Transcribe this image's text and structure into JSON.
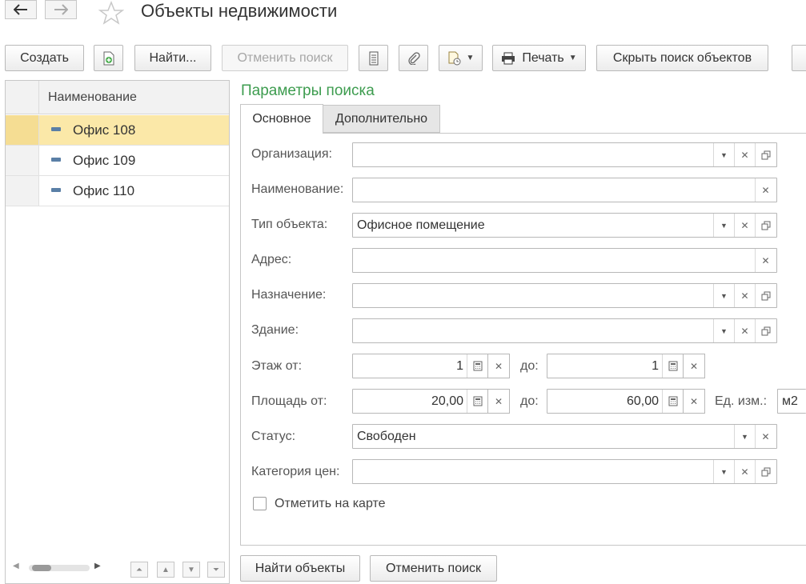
{
  "header": {
    "title": "Объекты недвижимости",
    "back_icon": "arrow-left-icon",
    "forward_icon": "arrow-right-icon",
    "favorite_icon": "star-icon"
  },
  "toolbar": {
    "create": "Создать",
    "find": "Найти...",
    "cancel_search": "Отменить поиск",
    "print": "Печать",
    "hide_search": "Скрыть поиск объектов"
  },
  "list": {
    "column_header": "Наименование",
    "rows": [
      {
        "name": "Офис 108",
        "selected": true
      },
      {
        "name": "Офис 109",
        "selected": false
      },
      {
        "name": "Офис 110",
        "selected": false
      }
    ]
  },
  "search": {
    "title": "Параметры поиска",
    "tabs": {
      "main": "Основное",
      "extra": "Дополнительно"
    },
    "fields": {
      "organization": {
        "label": "Организация:",
        "value": ""
      },
      "name": {
        "label": "Наименование:",
        "value": ""
      },
      "object_type": {
        "label": "Тип объекта:",
        "value": "Офисное помещение"
      },
      "address": {
        "label": "Адрес:",
        "value": ""
      },
      "purpose": {
        "label": "Назначение:",
        "value": ""
      },
      "building": {
        "label": "Здание:",
        "value": ""
      },
      "floor": {
        "label": "Этаж от:",
        "from": "1",
        "to_label": "до:",
        "to": "1"
      },
      "area": {
        "label": "Площадь от:",
        "from": "20,00",
        "to_label": "до:",
        "to": "60,00",
        "unit_label": "Ед. изм.:",
        "unit": "м2"
      },
      "status": {
        "label": "Статус:",
        "value": "Свободен"
      },
      "price_category": {
        "label": "Категория цен:",
        "value": ""
      }
    },
    "show_on_map": {
      "label": "Отметить на карте",
      "checked": false
    },
    "buttons": {
      "find": "Найти объекты",
      "cancel": "Отменить поиск"
    }
  },
  "colors": {
    "accent_green": "#3d9c4f",
    "selection": "#fbe8a8"
  }
}
